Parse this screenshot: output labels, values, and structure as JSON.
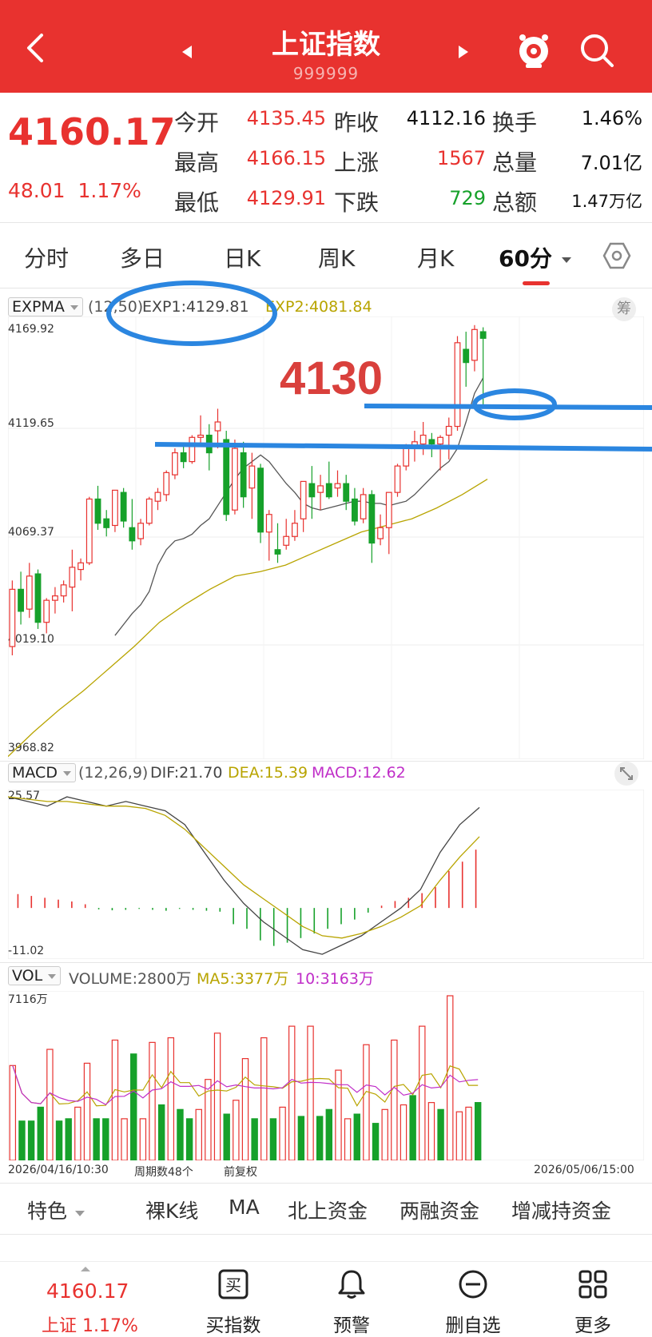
{
  "header": {
    "title": "上证指数",
    "code": "999999"
  },
  "quote": {
    "price": "4160.17",
    "change": "48.01",
    "change_pct": "1.17%",
    "open_label": "今开",
    "open": "4135.45",
    "high_label": "最高",
    "high": "4166.15",
    "low_label": "最低",
    "low": "4129.91",
    "prev_close_label": "昨收",
    "prev_close": "4112.16",
    "up_label": "上涨",
    "up": "1567",
    "down_label": "下跌",
    "down": "729",
    "turnover_label": "换手",
    "turnover": "1.46%",
    "volume_label": "总量",
    "volume": "7.01亿",
    "amount_label": "总额",
    "amount": "1.47万亿"
  },
  "tabs": [
    "分时",
    "多日",
    "日K",
    "周K",
    "月K",
    "60分"
  ],
  "main_chart": {
    "indicator": "EXPMA",
    "params": "(12,50)",
    "exp1": "EXP1:4129.81",
    "exp2": "EXP2:4081.84",
    "chip_button": "筹",
    "y_labels": [
      "4169.92",
      "4119.65",
      "4069.37",
      "4019.10",
      "3968.82"
    ],
    "annotation": "4130"
  },
  "macd_chart": {
    "indicator": "MACD",
    "params": "(12,26,9)",
    "dif": "DIF:21.70",
    "dea": "DEA:15.39",
    "macd": "MACD:12.62",
    "y_top": "25.57",
    "y_bottom": "-11.02"
  },
  "vol_chart": {
    "indicator": "VOL",
    "volume": "VOLUME:2800万",
    "ma5": "MA5:3377万",
    "ma10": "10:3163万",
    "y_top": "7116万",
    "start_time": "2026/04/16/10:30",
    "period_count": "周期数48个",
    "adjust": "前复权",
    "end_time": "2026/05/06/15:00"
  },
  "bottom_menu": [
    "特色",
    "裸K线",
    "MA",
    "北上资金",
    "两融资金",
    "增减持资金"
  ],
  "footer": {
    "price": "4160.17",
    "sub": "上证 1.17%",
    "buy_label": "买指数",
    "alert_label": "预警",
    "remove_label": "删自选",
    "more_label": "更多"
  },
  "colors": {
    "brand_red": "#e8322f",
    "up_red": "#e8322f",
    "down_green": "#16a12a",
    "exp1_line": "#555555",
    "exp2_line": "#b8a400",
    "dea_line": "#b8a400",
    "macd_purple": "#c02ec8",
    "annotation_blue": "#2b86e0"
  },
  "chart_data": {
    "type": "candlestick",
    "interval": "60分",
    "y_range": [
      3968.82,
      4169.92
    ],
    "candles_ohlc": [
      [
        4020,
        4050,
        4016,
        4046
      ],
      [
        4046,
        4054,
        4030,
        4036
      ],
      [
        4037,
        4058,
        4033,
        4052
      ],
      [
        4053,
        4055,
        4028,
        4031
      ],
      [
        4031,
        4042,
        4026,
        4041
      ],
      [
        4041,
        4047,
        4035,
        4043
      ],
      [
        4043,
        4050,
        4040,
        4048
      ],
      [
        4047,
        4064,
        4036,
        4056
      ],
      [
        4055,
        4060,
        4050,
        4058
      ],
      [
        4058,
        4088,
        4057,
        4087
      ],
      [
        4087,
        4093,
        4073,
        4076
      ],
      [
        4078,
        4082,
        4070,
        4074
      ],
      [
        4075,
        4091,
        4072,
        4091
      ],
      [
        4090,
        4092,
        4074,
        4077
      ],
      [
        4074,
        4087,
        4064,
        4068
      ],
      [
        4069,
        4078,
        4066,
        4076
      ],
      [
        4076,
        4088,
        4075,
        4087
      ],
      [
        4086,
        4092,
        4082,
        4090
      ],
      [
        4089,
        4100,
        4086,
        4099
      ],
      [
        4098,
        4110,
        4096,
        4108
      ],
      [
        4108,
        4112,
        4101,
        4104
      ],
      [
        4104,
        4116,
        4103,
        4115
      ],
      [
        4115,
        4125,
        4112,
        4116
      ],
      [
        4116,
        4121,
        4100,
        4108
      ],
      [
        4118,
        4128,
        4110,
        4122
      ],
      [
        4114,
        4118,
        4077,
        4080
      ],
      [
        4082,
        4114,
        4080,
        4110
      ],
      [
        4108,
        4113,
        4083,
        4088
      ],
      [
        4092,
        4108,
        4078,
        4102
      ],
      [
        4101,
        4103,
        4067,
        4072
      ],
      [
        4072,
        4082,
        4059,
        4080
      ],
      [
        4064,
        4076,
        4058,
        4062
      ],
      [
        4066,
        4078,
        4064,
        4070
      ],
      [
        4070,
        4082,
        4068,
        4076
      ],
      [
        4078,
        4095,
        4072,
        4095
      ],
      [
        4094,
        4102,
        4078,
        4088
      ],
      [
        4090,
        4098,
        4082,
        4093
      ],
      [
        4094,
        4104,
        4087,
        4088
      ],
      [
        4092,
        4100,
        4088,
        4094
      ],
      [
        4094,
        4098,
        4082,
        4086
      ],
      [
        4087,
        4092,
        4075,
        4077
      ],
      [
        4078,
        4092,
        4076,
        4089
      ],
      [
        4089,
        4091,
        4058,
        4067
      ],
      [
        4069,
        4080,
        4066,
        4074
      ],
      [
        4074,
        4090,
        4062,
        4090
      ],
      [
        4090,
        4103,
        4088,
        4102
      ],
      [
        4102,
        4112,
        4100,
        4110
      ],
      [
        4110,
        4118,
        4104,
        4113
      ],
      [
        4112,
        4122,
        4107,
        4116
      ],
      [
        4114,
        4117,
        4106,
        4112
      ],
      [
        4112,
        4116,
        4100,
        4115
      ],
      [
        4116,
        4124,
        4105,
        4120
      ],
      [
        4120,
        4161,
        4118,
        4158
      ],
      [
        4155,
        4163,
        4138,
        4149
      ],
      [
        4150,
        4166,
        4145,
        4164
      ],
      [
        4163,
        4165,
        4130,
        4160
      ]
    ],
    "exp1": [
      4025,
      4030,
      4035,
      4039,
      4045,
      4057,
      4064,
      4068,
      4069,
      4071,
      4075,
      4078,
      4084,
      4090,
      4096,
      4101,
      4104,
      4107,
      4104,
      4099,
      4094,
      4090,
      4085,
      4083,
      4082,
      4083,
      4084,
      4085,
      4086,
      4086,
      4085,
      4085,
      4084,
      4085,
      4086,
      4089,
      4093,
      4097,
      4101,
      4104,
      4110,
      4122,
      4135,
      4142
    ],
    "exp2": [
      3970,
      3981,
      3991,
      4000,
      4010,
      4020,
      4031,
      4039,
      4046,
      4052,
      4054,
      4057,
      4062,
      4067,
      4072,
      4075,
      4078,
      4083,
      4089,
      4096
    ],
    "macd": {
      "range": [
        -11.02,
        25.57
      ],
      "dif": [
        24,
        23,
        22,
        24,
        23,
        22,
        23,
        22,
        21,
        18,
        12,
        6,
        1,
        -3,
        -6,
        -9,
        -10,
        -8,
        -6,
        -3,
        0,
        4,
        12,
        18,
        21.7
      ],
      "dea": [
        24,
        23.5,
        23,
        23,
        22.5,
        22,
        22,
        21.5,
        20,
        17,
        13,
        9,
        5,
        2,
        -1,
        -4,
        -6,
        -6.5,
        -5.5,
        -4,
        -2,
        0.5,
        6,
        11,
        15.4
      ],
      "bars": [
        3,
        2.6,
        2.2,
        1.8,
        1.4,
        0.8,
        -0.3,
        -0.5,
        -0.4,
        -0.2,
        -0.4,
        -0.6,
        -0.2,
        -0.4,
        -0.6,
        -0.8,
        -3.5,
        -4.5,
        -7,
        -8.2,
        -7.5,
        -6.5,
        -5.5,
        -4.5,
        -3.5,
        -2.5,
        -1,
        0.5,
        1.5,
        2.2,
        3.2,
        4.5,
        8,
        10,
        12.6
      ]
    },
    "volume": {
      "max": 7116,
      "values": [
        4100,
        1700,
        1700,
        2300,
        4800,
        1700,
        1800,
        2300,
        4200,
        1800,
        1800,
        5200,
        1800,
        4600,
        1800,
        5100,
        2400,
        5300,
        2200,
        1800,
        2200,
        3500,
        5500,
        2000,
        2600,
        4400,
        1800,
        5300,
        1800,
        2300,
        5800,
        1900,
        5800,
        1900,
        2200,
        3900,
        1800,
        2000,
        5000,
        1600,
        2200,
        5200,
        2400,
        2800,
        5800,
        2500,
        2200,
        7116,
        2100,
        2300,
        2500
      ],
      "up": [
        true,
        false,
        false,
        false,
        true,
        false,
        false,
        true,
        true,
        false,
        false,
        true,
        true,
        false,
        true,
        true,
        false,
        true,
        false,
        false,
        true,
        true,
        true,
        false,
        true,
        true,
        false,
        true,
        false,
        true,
        true,
        false,
        true,
        false,
        false,
        true,
        true,
        false,
        true,
        false,
        true,
        true,
        true,
        false,
        true,
        true,
        false,
        true,
        true,
        true,
        false
      ]
    }
  }
}
